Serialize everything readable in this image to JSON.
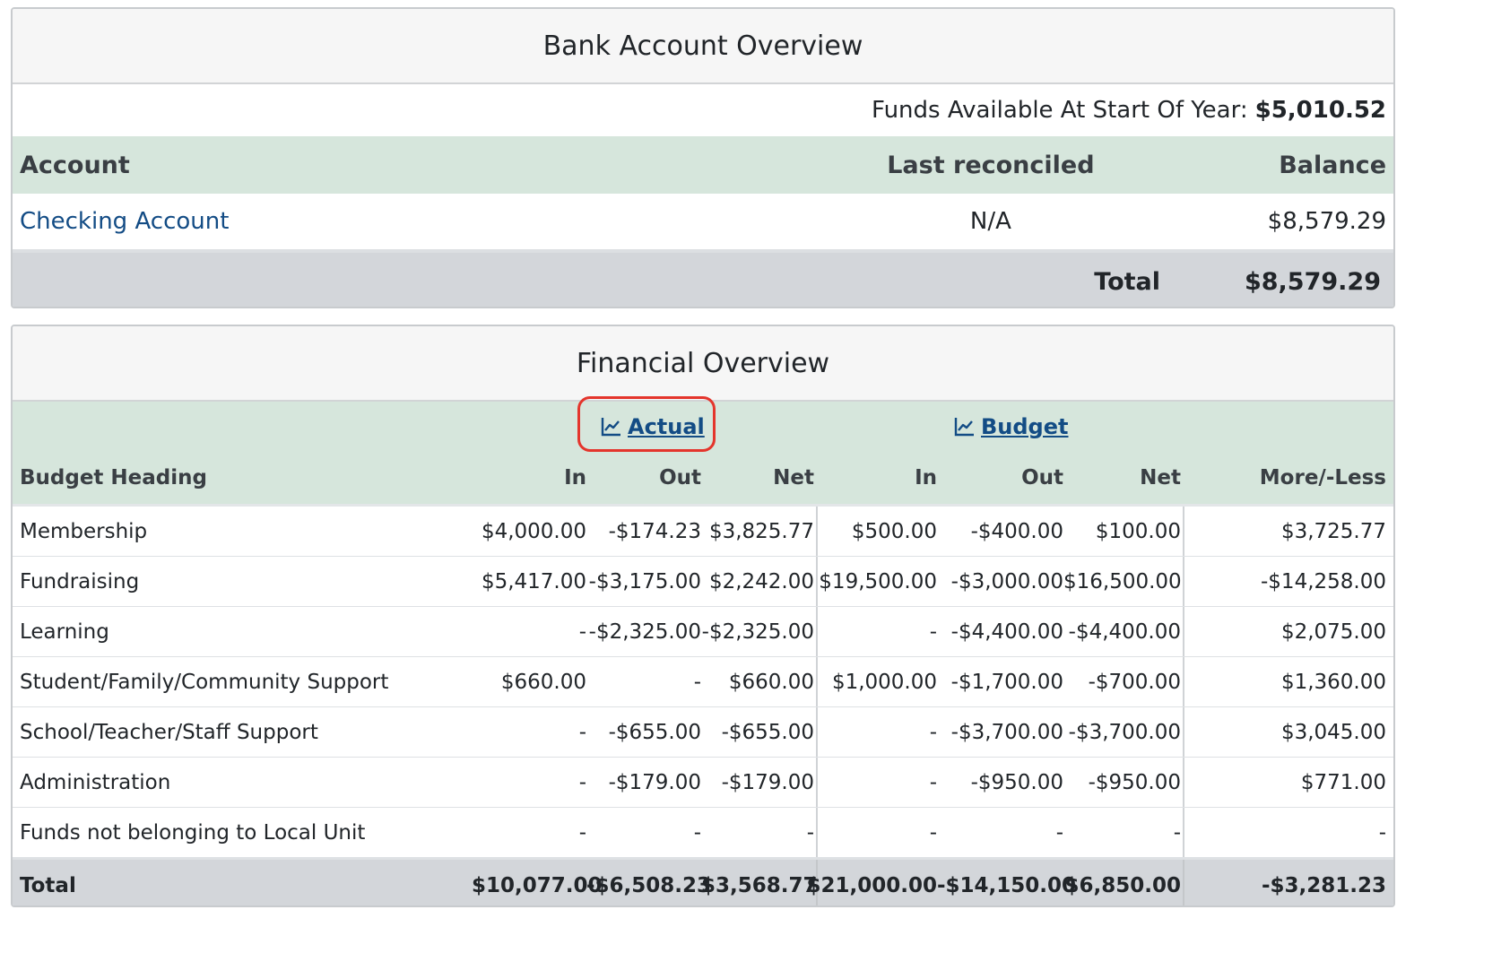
{
  "bank": {
    "title": "Bank Account Overview",
    "funds_label": "Funds Available At Start Of Year:",
    "funds_value": "$5,010.52",
    "headers": {
      "account": "Account",
      "last_reconciled": "Last reconciled",
      "balance": "Balance"
    },
    "accounts": [
      {
        "name": "Checking Account",
        "last_reconciled": "N/A",
        "balance": "$8,579.29"
      }
    ],
    "total_label": "Total",
    "total_value": "$8,579.29"
  },
  "financial": {
    "title": "Financial Overview",
    "group_actual": "Actual",
    "group_budget": "Budget",
    "headers": {
      "heading": "Budget Heading",
      "a_in": "In",
      "a_out": "Out",
      "a_net": "Net",
      "b_in": "In",
      "b_out": "Out",
      "b_net": "Net",
      "more": "More/-Less"
    },
    "rows": [
      {
        "heading": "Membership",
        "a_in": "$4,000.00",
        "a_out": "-$174.23",
        "a_net": "$3,825.77",
        "b_in": "$500.00",
        "b_out": "-$400.00",
        "b_net": "$100.00",
        "more": "$3,725.77"
      },
      {
        "heading": "Fundraising",
        "a_in": "$5,417.00",
        "a_out": "-$3,175.00",
        "a_net": "$2,242.00",
        "b_in": "$19,500.00",
        "b_out": "-$3,000.00",
        "b_net": "$16,500.00",
        "more": "-$14,258.00"
      },
      {
        "heading": "Learning",
        "a_in": "-",
        "a_out": "-$2,325.00",
        "a_net": "-$2,325.00",
        "b_in": "-",
        "b_out": "-$4,400.00",
        "b_net": "-$4,400.00",
        "more": "$2,075.00"
      },
      {
        "heading": "Student/Family/Community Support",
        "a_in": "$660.00",
        "a_out": "-",
        "a_net": "$660.00",
        "b_in": "$1,000.00",
        "b_out": "-$1,700.00",
        "b_net": "-$700.00",
        "more": "$1,360.00"
      },
      {
        "heading": "School/Teacher/Staff Support",
        "a_in": "-",
        "a_out": "-$655.00",
        "a_net": "-$655.00",
        "b_in": "-",
        "b_out": "-$3,700.00",
        "b_net": "-$3,700.00",
        "more": "$3,045.00"
      },
      {
        "heading": "Administration",
        "a_in": "-",
        "a_out": "-$179.00",
        "a_net": "-$179.00",
        "b_in": "-",
        "b_out": "-$950.00",
        "b_net": "-$950.00",
        "more": "$771.00"
      },
      {
        "heading": "Funds not belonging to Local Unit",
        "a_in": "-",
        "a_out": "-",
        "a_net": "-",
        "b_in": "-",
        "b_out": "-",
        "b_net": "-",
        "more": "-"
      }
    ],
    "total": {
      "heading": "Total",
      "a_in": "$10,077.00",
      "a_out": "-$6,508.23",
      "a_net": "$3,568.77",
      "b_in": "$21,000.00",
      "b_out": "-$14,150.00",
      "b_net": "$6,850.00",
      "more": "-$3,281.23"
    }
  },
  "colors": {
    "header_green": "#d6e6dc",
    "total_gray": "#d3d6da",
    "link_blue": "#134c85",
    "highlight_red": "#e4352c"
  },
  "icons": {
    "actual": "chart-line-icon",
    "budget": "chart-line-icon"
  }
}
